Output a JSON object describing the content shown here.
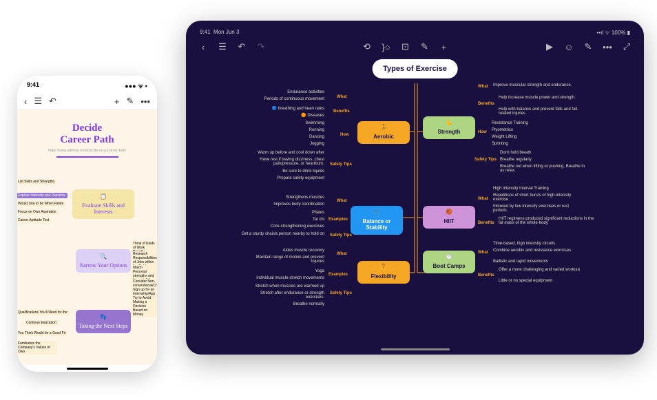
{
  "phone": {
    "time": "9:41",
    "title_l1": "Decide",
    "title_l2": "Career Path",
    "url": "https://www.wikihow.com/Decide-on-a-Career-Path",
    "node1": "Evaluate Skills and Interests",
    "node2": "Narrow Your Options",
    "node3": "Taking the Next Steps",
    "s1": "List Skills and Strengths",
    "s2": "Explore Interests and Passions",
    "s3": "Would Like to be When Retire",
    "s4": "Focus on Own Aspiration",
    "s5": "Career Aptitude Test",
    "s6": "Think of Kinds of Work Broadly",
    "s7": "Research Responsibilities of Jobs within the Field",
    "s8": "Match Personal strengths and Interest Jobs",
    "s9": "Consider Non-conventional/Cro",
    "s10": "Sign up for an Internship/App",
    "s11": "Try to Avoid Making a Decision Based on Money",
    "s12": "Qualifications You'll Need for the",
    "s13": "Continue Education",
    "s14": "You Think Would be a Good Fit",
    "s15": "Familiarize the Company's Values of Own"
  },
  "tablet": {
    "time": "9:41",
    "date": "Mon Jun 3",
    "battery": "100%",
    "root": "Types of Exercise",
    "cats": {
      "aerobic": "Aerobic",
      "balance": "Balance or Stability",
      "flexibility": "Flexibility",
      "strength": "Strength",
      "hiit": "HIIT",
      "bootcamps": "Boot Camps"
    },
    "labels": {
      "what": "What",
      "benefits": "Benefits",
      "how": "How",
      "safety": "Safety Tips",
      "examples": "Examples"
    },
    "aerobic": {
      "w1": "Endurance activities",
      "w2": "Periods of continuous movement",
      "b1": "breathing and heart rates",
      "b2": "Diseases",
      "h1": "Swimming",
      "h2": "Running",
      "h3": "Dancing",
      "h4": "Jogging",
      "s1": "Warm up before and cool down after",
      "s2": "Have rest if having dizziness, chest pain/pressure, or heartburn.",
      "s3": "Be sure to drink liquids",
      "s4": "Prepare safety equipment"
    },
    "balance": {
      "w1": "Strengthens muscles",
      "w2": "Improves body coordination",
      "e1": "Pilates",
      "e2": "Tai chi",
      "e3": "Core-strengthening exercises",
      "s1": "Get a sturdy chair/a person nearby to hold on"
    },
    "flex": {
      "w1": "Aides muscle recovery",
      "w2": "Maintain range of motion and prevent injuries",
      "e1": "Yoga",
      "e2": "Individual muscle-stretch movements",
      "s1": "Stretch when muscles are warmed up",
      "s2": "Stretch after endurance or strength exercises.",
      "s3": "Breathe normally"
    },
    "strength": {
      "w1": "Improve muscular strength and endurance.",
      "b1": "Help increase muscle power and strength.",
      "b2": "Help with balance and prevent falls and fall-related injuries",
      "h1": "Resistance Training",
      "h2": "Plyometrics",
      "h3": "Weight Lifting",
      "h4": "Sprinting",
      "s1": "Don't hold breath",
      "s2": "Breathe regularly.",
      "s3": "Breathe out when lifting or pushing. Breathe in as relax."
    },
    "hiit": {
      "w1": "High Intensity Interval Training",
      "w2": "Repetitions of short bursts of high-intensity exercise",
      "w3": "followed by low intensity exercises or rest periods.",
      "b1": "HIIT regimens produced significant reductions in the fat mass of the whole-body"
    },
    "boot": {
      "w1": "Time-based, high intensity circuits",
      "w2": "Combine aerobic and resistance exercises.",
      "w3": "Ballistic and rapid movements",
      "b1": "Offer a more challenging and varied workout",
      "b2": "Little or no special equipment"
    }
  }
}
